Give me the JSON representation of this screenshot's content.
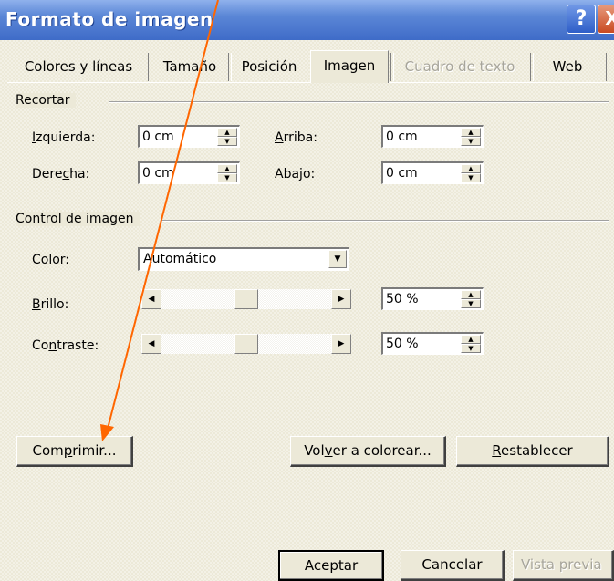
{
  "window": {
    "title": "Formato de imagen",
    "help_label": "?",
    "close_label": "X"
  },
  "tabs": [
    {
      "label": "Colores y líneas",
      "active": false,
      "enabled": true
    },
    {
      "label": "Tamaño",
      "active": false,
      "enabled": true
    },
    {
      "label": "Posición",
      "active": false,
      "enabled": true
    },
    {
      "label": "Imagen",
      "active": true,
      "enabled": true
    },
    {
      "label": "Cuadro de texto",
      "active": false,
      "enabled": false
    },
    {
      "label": "Web",
      "active": false,
      "enabled": true
    }
  ],
  "crop": {
    "group_label": "Recortar",
    "left": {
      "label_pre": "",
      "label_key": "I",
      "label_post": "zquierda:",
      "value": "0 cm"
    },
    "right": {
      "label_pre": "Dere",
      "label_key": "c",
      "label_post": "ha:",
      "value": "0 cm"
    },
    "top": {
      "label_pre": "",
      "label_key": "A",
      "label_post": "rriba:",
      "value": "0 cm"
    },
    "bottom": {
      "label_pre": "Aba",
      "label_key": "j",
      "label_post": "o:",
      "value": "0 cm"
    }
  },
  "image_control": {
    "group_label": "Control de imagen",
    "color": {
      "label_pre": "",
      "label_key": "C",
      "label_post": "olor:",
      "value": "Automático"
    },
    "brightness": {
      "label_pre": "",
      "label_key": "B",
      "label_post": "rillo:",
      "value": "50 %",
      "level": 0.5
    },
    "contrast": {
      "label_pre": "Co",
      "label_key": "n",
      "label_post": "traste:",
      "value": "50 %",
      "level": 0.5
    }
  },
  "buttons": {
    "compress": {
      "pre": "Com",
      "key": "p",
      "post": "rimir..."
    },
    "recolor": {
      "pre": "Vol",
      "key": "v",
      "post": "er a colorear..."
    },
    "reset": {
      "pre": "",
      "key": "R",
      "post": "establecer"
    },
    "ok": "Aceptar",
    "cancel": "Cancelar",
    "preview": "Vista previa"
  },
  "annotation": {
    "color": "#ff6600"
  }
}
